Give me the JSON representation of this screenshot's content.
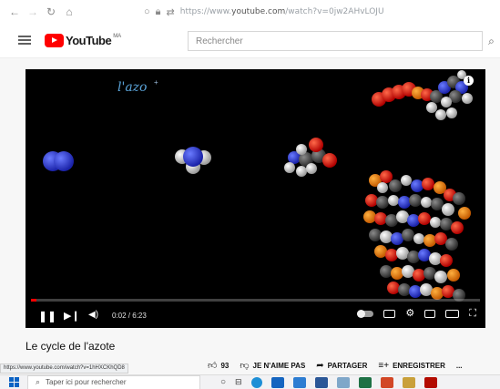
{
  "browser": {
    "url_prefix": "https://www.",
    "url_domain": "youtube.com",
    "url_suffix": "/watch?v=0jw2AHvLOJU"
  },
  "header": {
    "brand": "YouTube",
    "brand_suffix": "MA",
    "search_placeholder": "Rechercher"
  },
  "player": {
    "handwriting": "l'azo",
    "current_time": "0:02",
    "duration": "6:23",
    "time_display": "0:02 / 6:23",
    "progress": 0.005
  },
  "video": {
    "title": "Le cycle de l'azote",
    "likes": "93",
    "dislike_label": "JE N'AIME PAS",
    "share_label": "PARTAGER",
    "save_label": "ENREGISTRER",
    "more_label": "..."
  },
  "statusbar": {
    "url": "https://www.youtube.com/watch?v=1hHXCKhQD8"
  },
  "taskbar": {
    "search_placeholder": "Taper ici pour rechercher"
  },
  "colors": {
    "accent_red": "#ff0000",
    "handwriting_blue": "#5aa3d8",
    "windows_blue": "#0a62c4"
  }
}
